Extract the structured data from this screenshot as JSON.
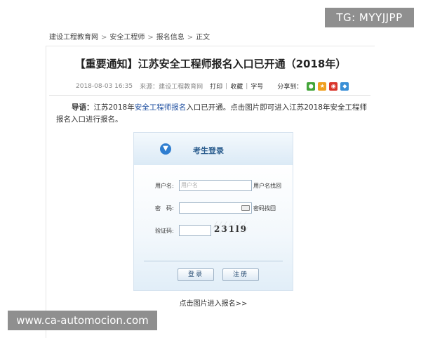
{
  "watermarks": {
    "top_right": "TG: MYYJJPP",
    "bottom_left": "www.ca-automocion.com"
  },
  "breadcrumb": [
    "建设工程教育网",
    "安全工程师",
    "报名信息",
    "正文"
  ],
  "breadcrumb_separator": ">",
  "article": {
    "title": "【重要通知】江苏安全工程师报名入口已开通（2018年）",
    "date": "2018-08-03 16:35",
    "source": "来源：建设工程教育网",
    "tools": {
      "print": "打印",
      "favorite": "收藏",
      "font_size": "字号"
    },
    "share_label": "分享到：",
    "intro": {
      "lead": "导语：",
      "text_before": "江苏2018年",
      "link": "安全工程师报名",
      "text_after": "入口已开通。点击图片即可进入江苏2018年安全工程师报名入口进行报名。"
    },
    "caption": "点击图片进入报名>>"
  },
  "login_form": {
    "title": "考生登录",
    "username_label": "用户名:",
    "username_placeholder": "用户名",
    "username_recover": "用户名找回",
    "password_label": "密　码:",
    "password_recover": "密码找回",
    "captcha_label": "验证码:",
    "captcha_text": "231l9",
    "login_button": "登录",
    "register_button": "注册"
  },
  "colors": {
    "link": "#1f4fa0",
    "share_wechat": "#44a53a",
    "share_qzone": "#f0a020",
    "share_weibo": "#d9352b",
    "share_other": "#3a8fd6"
  }
}
